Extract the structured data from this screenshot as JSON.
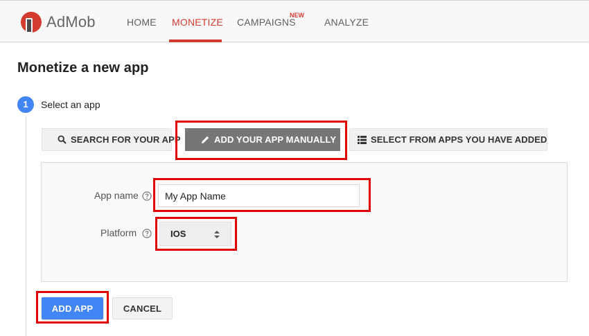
{
  "app": {
    "brand": "AdMob",
    "brand_color": "#d23b30"
  },
  "nav": {
    "items": [
      {
        "label": "HOME",
        "active": false
      },
      {
        "label": "MONETIZE",
        "active": true
      },
      {
        "label": "CAMPAIGNS",
        "active": false,
        "badge": "NEW"
      },
      {
        "label": "ANALYZE",
        "active": false
      }
    ]
  },
  "page": {
    "title": "Monetize a new app"
  },
  "step": {
    "number": "1",
    "label": "Select an app"
  },
  "choices": [
    {
      "label": "SEARCH FOR YOUR APP",
      "icon": "search-icon",
      "selected": false
    },
    {
      "label": "ADD YOUR APP MANUALLY",
      "icon": "pencil-icon",
      "selected": true
    },
    {
      "label": "SELECT FROM APPS YOU HAVE ADDED",
      "icon": "list-icon",
      "selected": false
    }
  ],
  "form": {
    "app_name_label": "App name",
    "app_name_value": "My App Name",
    "platform_label": "Platform",
    "platform_value": "IOS"
  },
  "actions": {
    "add_label": "ADD APP",
    "cancel_label": "CANCEL"
  },
  "colors": {
    "accent_blue": "#4285f4",
    "highlight_red": "#e00000",
    "selected_gray": "#767676"
  }
}
